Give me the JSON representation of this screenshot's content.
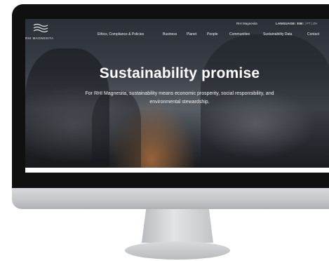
{
  "topbar": {
    "brand_link": "RHI Magnesita",
    "language_label": "LANGUAGE: EN",
    "languages": "DE | PT | ZH"
  },
  "logo": {
    "name": "RHI MAGNESITA"
  },
  "nav": {
    "items": [
      {
        "label": "Ethics, Compliance & Policies"
      },
      {
        "label": "Business"
      },
      {
        "label": "Planet"
      },
      {
        "label": "People"
      },
      {
        "label": "Communities"
      },
      {
        "label": "Sustainability Data"
      },
      {
        "label": "Contact"
      }
    ]
  },
  "hero": {
    "title": "Sustainability promise",
    "subtitle": "For RHI Magnesita, sustainability means economic prosperity, social responsibility, and environmental stewardship."
  },
  "colors": {
    "bezel": "#101010",
    "hero_text": "#ffffff",
    "monitor_chin": "#c3c5c8"
  }
}
